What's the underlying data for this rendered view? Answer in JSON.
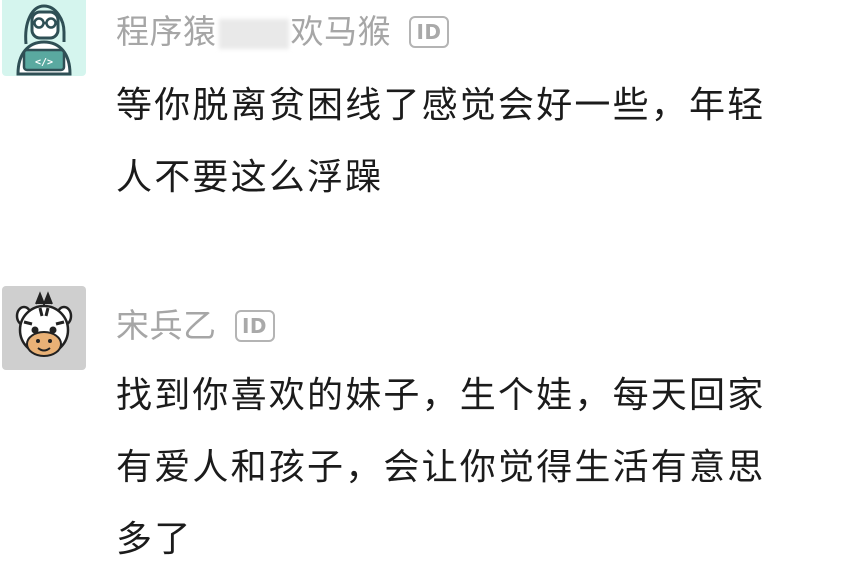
{
  "comments": [
    {
      "avatar_icon": "programmer-avatar-icon",
      "username_prefix": "程序猿",
      "username_suffix": "欢马猴",
      "username_partially_obscured": true,
      "id_badge": "ID",
      "lines": [
        "等你脱离贫困线了感觉会好一些，年轻",
        "人不要这么浮躁"
      ]
    },
    {
      "avatar_icon": "zebra-avatar-icon",
      "username": "宋兵乙",
      "id_badge": "ID",
      "lines": [
        "找到你喜欢的妹子，生个娃，每天回家",
        "有爱人和孩子，会让你觉得生活有意思",
        "多了"
      ]
    }
  ],
  "colors": {
    "username": "#a6a6a6",
    "body_text": "#1b1b1b",
    "avatar1_bg": "#d5f5ee",
    "avatar2_bg": "#cfcfcf"
  }
}
